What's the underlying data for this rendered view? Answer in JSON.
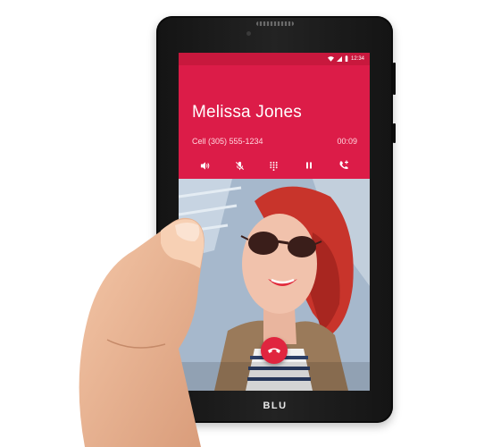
{
  "status_bar": {
    "time": "12:34",
    "icons": [
      "wifi-icon",
      "signal-icon",
      "battery-icon"
    ]
  },
  "call": {
    "caller_name": "Melissa Jones",
    "caller_number": "Cell (305) 555-1234",
    "duration": "00:09"
  },
  "controls": [
    {
      "name": "speaker-button",
      "icon": "speaker-icon"
    },
    {
      "name": "mute-button",
      "icon": "mic-off-icon"
    },
    {
      "name": "dialpad-button",
      "icon": "dialpad-icon"
    },
    {
      "name": "hold-button",
      "icon": "pause-icon"
    },
    {
      "name": "add-call-button",
      "icon": "add-call-icon"
    }
  ],
  "end_call": {
    "icon": "end-call-icon"
  },
  "device": {
    "brand": "BLU"
  },
  "colors": {
    "call_header": "#dc1c48",
    "status_bar": "#c8183d",
    "end_call": "#e0253f",
    "text_on_header": "#ffffff"
  }
}
